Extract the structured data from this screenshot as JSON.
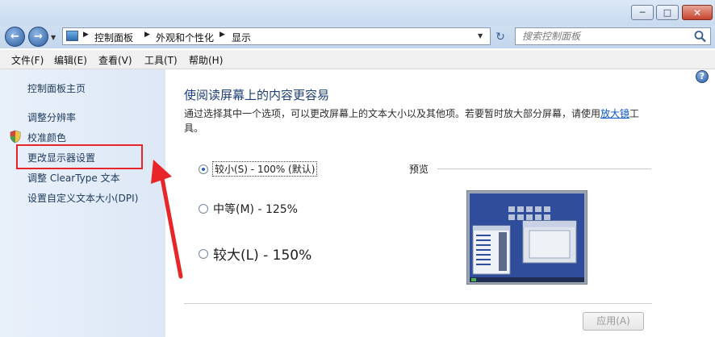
{
  "window": {
    "controls": {
      "minimize_icon": "minimize-icon",
      "maximize_icon": "maximize-icon",
      "close_icon": "close-icon"
    }
  },
  "nav": {
    "breadcrumb": [
      "控制面板",
      "外观和个性化",
      "显示"
    ],
    "search_placeholder": "搜索控制面板"
  },
  "menu": [
    "文件(F)",
    "编辑(E)",
    "查看(V)",
    "工具(T)",
    "帮助(H)"
  ],
  "sidebar": {
    "items": [
      {
        "label": "控制面板主页"
      },
      {
        "label": "调整分辨率"
      },
      {
        "label": "校准颜色"
      },
      {
        "label": "更改显示器设置"
      },
      {
        "label": "调整 ClearType 文本"
      },
      {
        "label": "设置自定义文本大小(DPI)"
      }
    ]
  },
  "main": {
    "title": "使阅读屏幕上的内容更容易",
    "description_prefix": "通过选择其中一个选项，可以更改屏幕上的文本大小以及其他项。若要暂时放大部分屏幕，请使用",
    "description_link": "放大镜",
    "description_suffix": "工具。",
    "options": [
      {
        "label": "较小(S) - 100% (默认)",
        "selected": true
      },
      {
        "label": "中等(M) - 125%",
        "selected": false
      },
      {
        "label": "较大(L) - 150%",
        "selected": false
      }
    ],
    "preview_label": "预览",
    "apply_label": "应用(A)"
  },
  "colors": {
    "annotation": "#e8262a",
    "link": "#0b57c7",
    "title": "#1e3f7a"
  }
}
